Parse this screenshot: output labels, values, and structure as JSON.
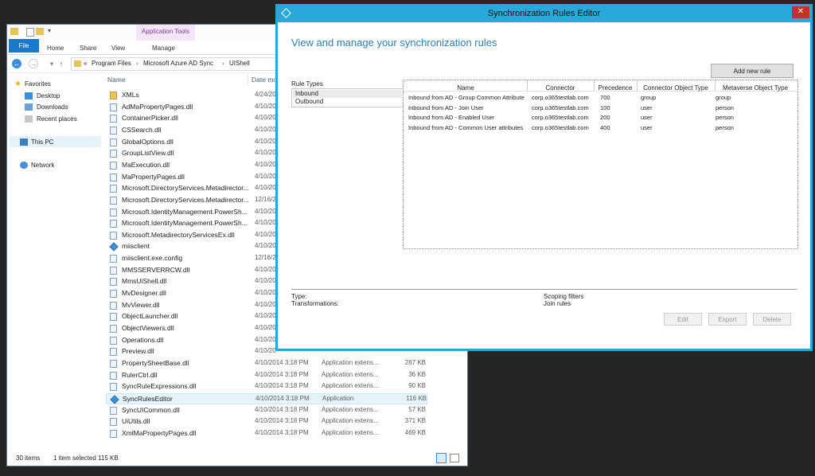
{
  "explorer": {
    "context_tab": "Application Tools",
    "tabs": [
      "File",
      "Home",
      "Share",
      "View",
      "Manage"
    ],
    "breadcrumb": [
      "«",
      "Program Files",
      "Microsoft Azure AD Sync",
      "UIShell"
    ],
    "nav": {
      "favorites": "Favorites",
      "desktop": "Desktop",
      "downloads": "Downloads",
      "recent": "Recent places",
      "this_pc": "This PC",
      "network": "Network"
    },
    "columns": {
      "name": "Name",
      "date": "Date mo"
    },
    "files": [
      {
        "name": "XMLs",
        "date": "4/24/20",
        "type": "",
        "size": "",
        "kind": "folder"
      },
      {
        "name": "AdMaPropertyPages.dll",
        "date": "4/10/20",
        "type": "",
        "size": "",
        "kind": "dll"
      },
      {
        "name": "ContainerPicker.dll",
        "date": "4/10/20",
        "type": "",
        "size": "",
        "kind": "dll"
      },
      {
        "name": "CSSearch.dll",
        "date": "4/10/20",
        "type": "",
        "size": "",
        "kind": "dll"
      },
      {
        "name": "GlobalOptions.dll",
        "date": "4/10/20",
        "type": "",
        "size": "",
        "kind": "dll"
      },
      {
        "name": "GroupListView.dll",
        "date": "4/10/20",
        "type": "",
        "size": "",
        "kind": "dll"
      },
      {
        "name": "MaExecution.dll",
        "date": "4/10/20",
        "type": "",
        "size": "",
        "kind": "dll"
      },
      {
        "name": "MaPropertyPages.dll",
        "date": "4/10/20",
        "type": "",
        "size": "",
        "kind": "dll"
      },
      {
        "name": "Microsoft.DirectoryServices.Metadirector...",
        "date": "4/10/20",
        "type": "",
        "size": "",
        "kind": "dll"
      },
      {
        "name": "Microsoft.DirectoryServices.Metadirector...",
        "date": "12/16/20",
        "type": "",
        "size": "",
        "kind": "dll"
      },
      {
        "name": "Microsoft.IdentityManagement.PowerSh...",
        "date": "4/10/20",
        "type": "",
        "size": "",
        "kind": "dll"
      },
      {
        "name": "Microsoft.IdentityManagement.PowerSh...",
        "date": "4/10/20",
        "type": "",
        "size": "",
        "kind": "dll"
      },
      {
        "name": "Microsoft.MetadirectoryServicesEx.dll",
        "date": "4/10/20",
        "type": "",
        "size": "",
        "kind": "dll"
      },
      {
        "name": "miisclient",
        "date": "4/10/20",
        "type": "",
        "size": "",
        "kind": "app"
      },
      {
        "name": "miisclient.exe.config",
        "date": "12/16/20",
        "type": "",
        "size": "",
        "kind": "file"
      },
      {
        "name": "MMSSERVERRCW.dll",
        "date": "4/10/20",
        "type": "",
        "size": "",
        "kind": "dll"
      },
      {
        "name": "MmsUiShell.dll",
        "date": "4/10/20",
        "type": "",
        "size": "",
        "kind": "dll"
      },
      {
        "name": "MvDesigner.dll",
        "date": "4/10/20",
        "type": "",
        "size": "",
        "kind": "dll"
      },
      {
        "name": "MvViewer.dll",
        "date": "4/10/20",
        "type": "",
        "size": "",
        "kind": "dll"
      },
      {
        "name": "ObjectLauncher.dll",
        "date": "4/10/20",
        "type": "",
        "size": "",
        "kind": "dll"
      },
      {
        "name": "ObjectViewers.dll",
        "date": "4/10/20",
        "type": "",
        "size": "",
        "kind": "dll"
      },
      {
        "name": "Operations.dll",
        "date": "4/10/20",
        "type": "",
        "size": "",
        "kind": "dll"
      },
      {
        "name": "Preview.dll",
        "date": "4/10/20",
        "type": "",
        "size": "",
        "kind": "dll"
      },
      {
        "name": "PropertySheetBase.dll",
        "date": "4/10/2014 3:18 PM",
        "type": "Application extens...",
        "size": "287 KB",
        "kind": "dll"
      },
      {
        "name": "RulerCtrl.dll",
        "date": "4/10/2014 3:18 PM",
        "type": "Application extens...",
        "size": "36 KB",
        "kind": "dll"
      },
      {
        "name": "SyncRuleExpressions.dll",
        "date": "4/10/2014 3:18 PM",
        "type": "Application extens...",
        "size": "90 KB",
        "kind": "dll"
      },
      {
        "name": "SyncRulesEditor",
        "date": "4/10/2014 3:18 PM",
        "type": "Application",
        "size": "116 KB",
        "kind": "app",
        "selected": true
      },
      {
        "name": "SyncUICommon.dll",
        "date": "4/10/2014 3:18 PM",
        "type": "Application extens...",
        "size": "57 KB",
        "kind": "dll"
      },
      {
        "name": "UiUtils.dll",
        "date": "4/10/2014 3:18 PM",
        "type": "Application extens...",
        "size": "371 KB",
        "kind": "dll"
      },
      {
        "name": "XmlMaPropertyPages.dll",
        "date": "4/10/2014 3:18 PM",
        "type": "Application extens...",
        "size": "469 KB",
        "kind": "dll"
      }
    ],
    "status": {
      "count": "30 items",
      "selected": "1 item selected  115 KB"
    }
  },
  "editor": {
    "title": "Synchronization Rules Editor",
    "close": "✕",
    "heading": "View and manage your synchronization rules",
    "add_button": "Add new rule",
    "rule_types_label": "Rule Types",
    "rule_types": [
      "Inbound",
      "Outbound"
    ],
    "columns": [
      "Name",
      "Connector",
      "Precedence",
      "Connector Object Type",
      "Metaverse Object Type"
    ],
    "rules": [
      [
        "Inbound from AD - Group Common Attribute",
        "corp.o365testlab.com",
        "700",
        "group",
        "group"
      ],
      [
        "Inbound from AD - Join User",
        "corp.o365testlab.com",
        "100",
        "user",
        "person"
      ],
      [
        "Inbound from AD - Enabled User",
        "corp.o365testlab.com",
        "200",
        "user",
        "person"
      ],
      [
        "Inbound from AD - Common User attributes",
        "corp.o365testlab.com",
        "400",
        "user",
        "person"
      ]
    ],
    "details": {
      "type": "Type:",
      "transformations": "Transformations:",
      "scoping": "Scoping filters",
      "join": "Join rules"
    },
    "buttons": {
      "edit": "Edit",
      "export": "Export",
      "delete": "Delete"
    }
  }
}
